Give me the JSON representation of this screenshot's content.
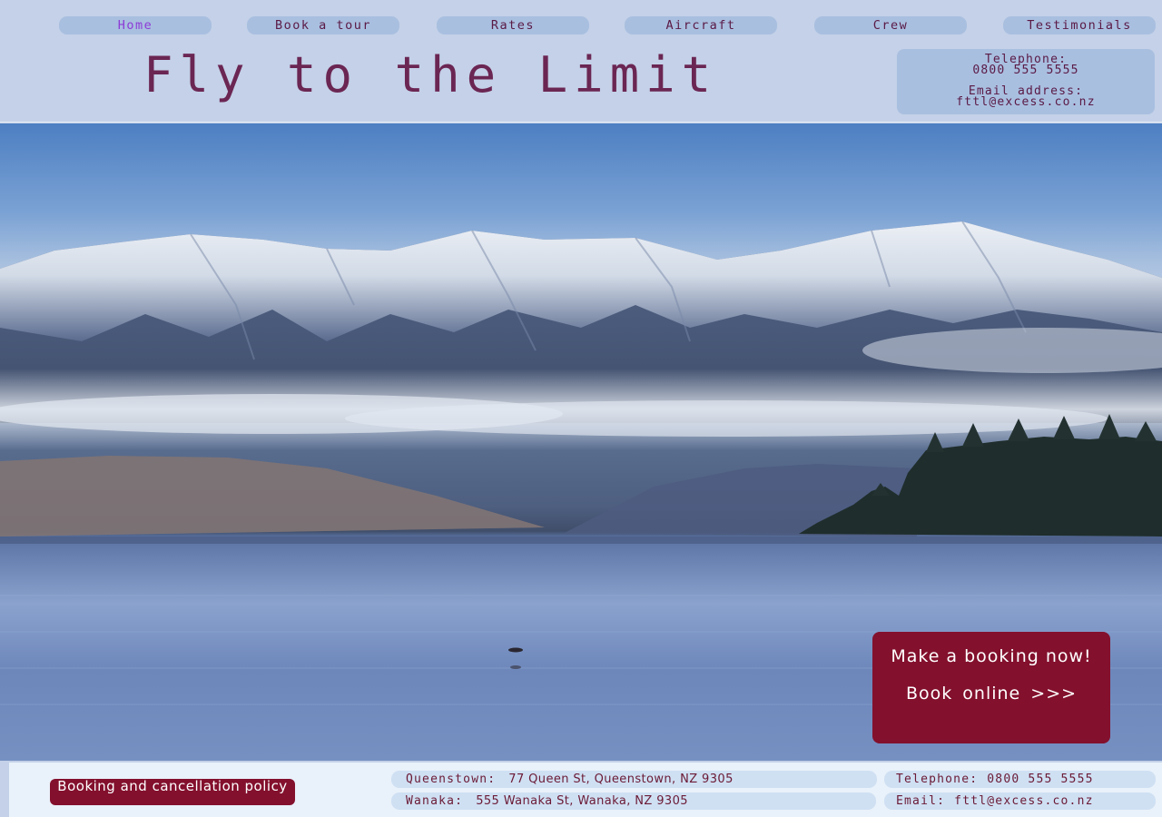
{
  "nav": {
    "items": [
      {
        "label": "Home",
        "active": true
      },
      {
        "label": "Book a tour"
      },
      {
        "label": "Rates"
      },
      {
        "label": "Aircraft"
      },
      {
        "label": "Crew"
      },
      {
        "label": "Testimonials"
      }
    ]
  },
  "header": {
    "title": "Fly to the Limit",
    "contact": {
      "phone_label": "Telephone:",
      "phone": "0800 555 5555",
      "email_label": "Email address:",
      "email": "fttl@excess.co.nz"
    }
  },
  "hero": {
    "image": "snowy-mountains-lake-photo",
    "cta_line1": "Make a booking now!",
    "cta_line2": "Book online >>>"
  },
  "footer": {
    "policy_button": "Booking and cancellation policy",
    "queenstown_label": "Queenstown:",
    "queenstown_address": "77 Queen St, Queenstown, NZ 9305",
    "wanaka_label": "Wanaka:",
    "wanaka_address": "555 Wanaka St, Wanaka, NZ 9305",
    "phone_label": "Telephone:",
    "phone": "0800 555 5555",
    "email_label": "Email:",
    "email": "fttl@excess.co.nz"
  },
  "colors": {
    "header_bg": "#c4d1e8",
    "nav_pill": "#a9bfe0",
    "title": "#6b2653",
    "accent": "#83102d",
    "active_nav": "#8d3bd6",
    "footer_bg": "#e9f1fa"
  }
}
